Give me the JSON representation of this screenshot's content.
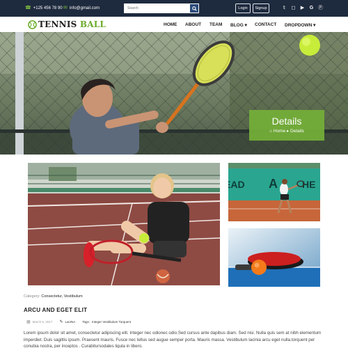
{
  "topbar": {
    "phone": "+125 456 78 90",
    "email": "info@gmail.com",
    "search_placeholder": "Search",
    "login_label": "Login",
    "signup_label": "Signup",
    "social_icons": [
      "twitter-icon",
      "instagram-icon",
      "youtube-icon",
      "google-icon",
      "pinterest-icon"
    ]
  },
  "brand": {
    "name_main": "TENNIS",
    "name_accent": "BALL",
    "accent_color": "#6cac2c"
  },
  "nav": {
    "items": [
      "HOME",
      "ABOUT",
      "TEAM",
      "BLOG",
      "CONTACT",
      "DROPDOWN"
    ]
  },
  "hero": {
    "title": "Details",
    "crumb_home": "Home",
    "crumb_current": "Details"
  },
  "post": {
    "category_label": "Category:",
    "categories": "Consectetur, Vestibulum",
    "title": "ARCU AND EGET ELIT",
    "date": "March 5, 2017",
    "author": "LacINA",
    "tags_label": "Tags:",
    "tags": "Integer Vestibulum Torquent",
    "excerpt": "Lorem ipsum dolor sit amet, consectetur adipiscing elit. Integer nec odionec odio.Sed cursus ante dapibus diam. Sed nisi. Nulla quis sem at nibh elementum imperdiet. Duis sagittis ipsum. Praesent mauris. Fusce nec tellus sed augue semper porta. Mauris massa. Vestibulum lacinia arcu eget nulla.torquent per conubia nostra, per inceptos . Curabitursodales ligula in libero."
  },
  "colors": {
    "topbar_bg": "#1e2a3e",
    "accent": "#74b038"
  }
}
